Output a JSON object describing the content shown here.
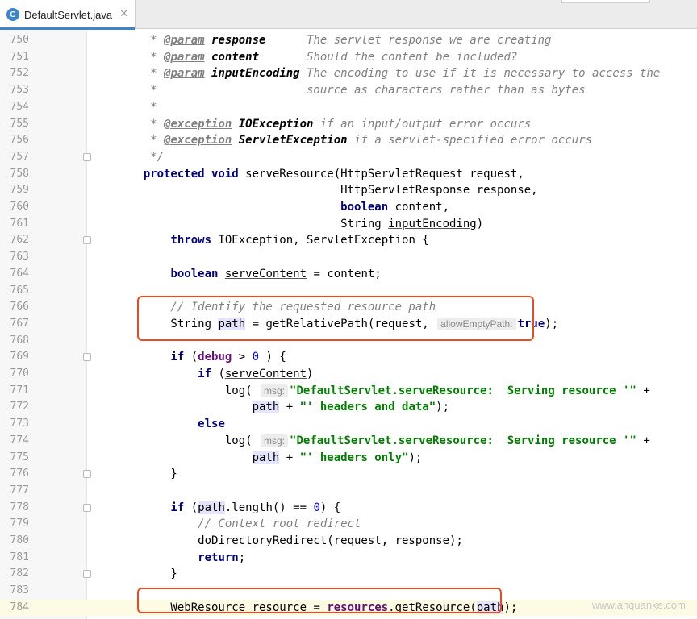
{
  "tab": {
    "icon_letter": "C",
    "filename": "DefaultServlet.java",
    "close_glyph": "✕"
  },
  "lines": [
    {
      "n": "750",
      "fold": false,
      "parts": [
        [
          "cm",
          "     * "
        ],
        [
          "tag",
          "@param"
        ],
        [
          "cm",
          " "
        ],
        [
          "tagp",
          "response"
        ],
        [
          "cm",
          "      The servlet response we are creating"
        ]
      ]
    },
    {
      "n": "751",
      "fold": false,
      "parts": [
        [
          "cm",
          "     * "
        ],
        [
          "tag",
          "@param"
        ],
        [
          "cm",
          " "
        ],
        [
          "tagp",
          "content"
        ],
        [
          "cm",
          "       Should the content be included?"
        ]
      ]
    },
    {
      "n": "752",
      "fold": false,
      "parts": [
        [
          "cm",
          "     * "
        ],
        [
          "tag",
          "@param"
        ],
        [
          "cm",
          " "
        ],
        [
          "tagp",
          "inputEncoding"
        ],
        [
          "cm",
          " The encoding to use if it is necessary to access the"
        ]
      ]
    },
    {
      "n": "753",
      "fold": false,
      "parts": [
        [
          "cm",
          "     *                      source as characters rather than as bytes"
        ]
      ]
    },
    {
      "n": "754",
      "fold": false,
      "parts": [
        [
          "cm",
          "     *"
        ]
      ]
    },
    {
      "n": "755",
      "fold": false,
      "parts": [
        [
          "cm",
          "     * "
        ],
        [
          "tag",
          "@exception"
        ],
        [
          "cm",
          " "
        ],
        [
          "tagp",
          "IOException"
        ],
        [
          "cm",
          " if an input/output error occurs"
        ]
      ]
    },
    {
      "n": "756",
      "fold": false,
      "parts": [
        [
          "cm",
          "     * "
        ],
        [
          "tag",
          "@exception"
        ],
        [
          "cm",
          " "
        ],
        [
          "tagp",
          "ServletException"
        ],
        [
          "cm",
          " if a servlet-specified error occurs"
        ]
      ]
    },
    {
      "n": "757",
      "fold": true,
      "parts": [
        [
          "cm",
          "     */"
        ]
      ]
    },
    {
      "n": "758",
      "fold": false,
      "parts": [
        [
          "",
          "    "
        ],
        [
          "kw",
          "protected void"
        ],
        [
          "",
          " serveResource(HttpServletRequest request,"
        ]
      ]
    },
    {
      "n": "759",
      "fold": false,
      "parts": [
        [
          "",
          "                                 HttpServletResponse response,"
        ]
      ]
    },
    {
      "n": "760",
      "fold": false,
      "parts": [
        [
          "",
          "                                 "
        ],
        [
          "kw",
          "boolean"
        ],
        [
          "",
          " content,"
        ]
      ]
    },
    {
      "n": "761",
      "fold": false,
      "parts": [
        [
          "",
          "                                 String "
        ],
        [
          "ul",
          "inputEncoding"
        ],
        [
          "",
          ")"
        ]
      ]
    },
    {
      "n": "762",
      "fold": true,
      "parts": [
        [
          "",
          "        "
        ],
        [
          "kw",
          "throws"
        ],
        [
          "",
          " IOException, ServletException {"
        ]
      ]
    },
    {
      "n": "763",
      "fold": false,
      "parts": []
    },
    {
      "n": "764",
      "fold": false,
      "parts": [
        [
          "",
          "        "
        ],
        [
          "kw",
          "boolean"
        ],
        [
          "",
          " "
        ],
        [
          "ul",
          "serveContent"
        ],
        [
          "",
          " = content;"
        ]
      ]
    },
    {
      "n": "765",
      "fold": false,
      "parts": []
    },
    {
      "n": "766",
      "fold": false,
      "parts": [
        [
          "cm",
          "        // Identify the requested resource path"
        ]
      ]
    },
    {
      "n": "767",
      "fold": false,
      "parts": [
        [
          "",
          "        String "
        ],
        [
          "varhl",
          "path"
        ],
        [
          "",
          " = getRelativePath(request, "
        ],
        [
          "hint",
          "allowEmptyPath:"
        ],
        [
          "kw",
          "true"
        ],
        [
          "",
          ");"
        ]
      ]
    },
    {
      "n": "768",
      "fold": false,
      "parts": []
    },
    {
      "n": "769",
      "fold": true,
      "parts": [
        [
          "",
          "        "
        ],
        [
          "kw",
          "if"
        ],
        [
          "",
          " ("
        ],
        [
          "fld",
          "debug"
        ],
        [
          "",
          " > "
        ],
        [
          "num",
          "0"
        ],
        [
          "",
          " ) {"
        ]
      ]
    },
    {
      "n": "770",
      "fold": false,
      "parts": [
        [
          "",
          "            "
        ],
        [
          "kw",
          "if"
        ],
        [
          "",
          " ("
        ],
        [
          "ul",
          "serveContent"
        ],
        [
          "",
          ")"
        ]
      ]
    },
    {
      "n": "771",
      "fold": false,
      "parts": [
        [
          "",
          "                log( "
        ],
        [
          "hint",
          "msg:"
        ],
        [
          "str",
          "\"DefaultServlet.serveResource:  Serving resource '\""
        ],
        [
          "",
          " +"
        ]
      ]
    },
    {
      "n": "772",
      "fold": false,
      "parts": [
        [
          "",
          "                    "
        ],
        [
          "varhl",
          "path"
        ],
        [
          "",
          " + "
        ],
        [
          "str",
          "\"' headers and data\""
        ],
        [
          "",
          ");"
        ]
      ]
    },
    {
      "n": "773",
      "fold": false,
      "parts": [
        [
          "",
          "            "
        ],
        [
          "kw",
          "else"
        ]
      ]
    },
    {
      "n": "774",
      "fold": false,
      "parts": [
        [
          "",
          "                log( "
        ],
        [
          "hint",
          "msg:"
        ],
        [
          "str",
          "\"DefaultServlet.serveResource:  Serving resource '\""
        ],
        [
          "",
          " +"
        ]
      ]
    },
    {
      "n": "775",
      "fold": false,
      "parts": [
        [
          "",
          "                    "
        ],
        [
          "varhl",
          "path"
        ],
        [
          "",
          " + "
        ],
        [
          "str",
          "\"' headers only\""
        ],
        [
          "",
          ");"
        ]
      ]
    },
    {
      "n": "776",
      "fold": true,
      "parts": [
        [
          "",
          "        }"
        ]
      ]
    },
    {
      "n": "777",
      "fold": false,
      "parts": []
    },
    {
      "n": "778",
      "fold": true,
      "parts": [
        [
          "",
          "        "
        ],
        [
          "kw",
          "if"
        ],
        [
          "",
          " ("
        ],
        [
          "varhl",
          "path"
        ],
        [
          "",
          ".length() == "
        ],
        [
          "num",
          "0"
        ],
        [
          "",
          ") {"
        ]
      ]
    },
    {
      "n": "779",
      "fold": false,
      "parts": [
        [
          "cm",
          "            // Context root redirect"
        ]
      ]
    },
    {
      "n": "780",
      "fold": false,
      "parts": [
        [
          "",
          "            doDirectoryRedirect(request, response);"
        ]
      ]
    },
    {
      "n": "781",
      "fold": false,
      "parts": [
        [
          "",
          "            "
        ],
        [
          "kw",
          "return"
        ],
        [
          "",
          ";"
        ]
      ]
    },
    {
      "n": "782",
      "fold": true,
      "parts": [
        [
          "",
          "        }"
        ]
      ]
    },
    {
      "n": "783",
      "fold": false,
      "parts": []
    },
    {
      "n": "784",
      "fold": false,
      "current": true,
      "parts": [
        [
          "",
          "        WebResource "
        ],
        [
          "ul",
          "resource"
        ],
        [
          "",
          " = "
        ],
        [
          "fld",
          "resources"
        ],
        [
          "",
          ".getResource("
        ],
        [
          "varhl",
          "path"
        ],
        [
          "",
          ");"
        ]
      ]
    }
  ],
  "watermark": "www.anquanke.com"
}
